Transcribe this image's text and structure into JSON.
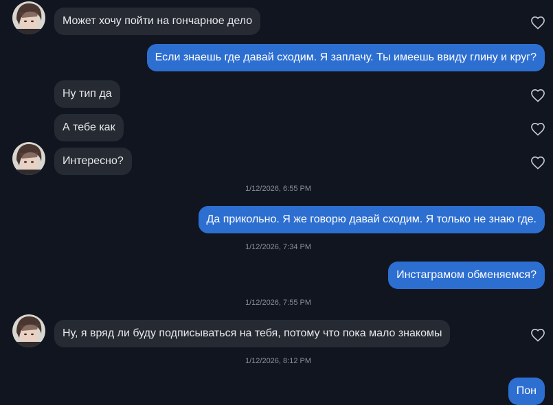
{
  "messages": {
    "m1": "Может хочу пойти на гончарное дело",
    "m2": "Если знаешь где давай сходим. Я заплачу. Ты имеешь ввиду глину и круг?",
    "m3": "Ну тип да",
    "m4": "А тебе как",
    "m5": "Интересно?",
    "m6": "Да прикольно. Я же говорю давай сходим. Я только не знаю где.",
    "m7": "Инстаграмом обменяемся?",
    "m8": "Ну, я вряд ли буду подписываться на тебя, потому что пока мало знакомы",
    "m9": "Пон"
  },
  "timestamps": {
    "t1": "1/12/2026, 6:55 PM",
    "t2": "1/12/2026, 7:34 PM",
    "t3": "1/12/2026, 7:55 PM",
    "t4": "1/12/2026, 8:12 PM"
  },
  "icons": {
    "like": "heart-outline-icon",
    "avatar": "contact-avatar-photo"
  },
  "colors": {
    "background": "#11151f",
    "incoming_bubble": "#262a33",
    "outgoing_bubble": "#2d6fd1",
    "timestamp_text": "#8b8f97",
    "heart_stroke": "#c9ccd2"
  }
}
